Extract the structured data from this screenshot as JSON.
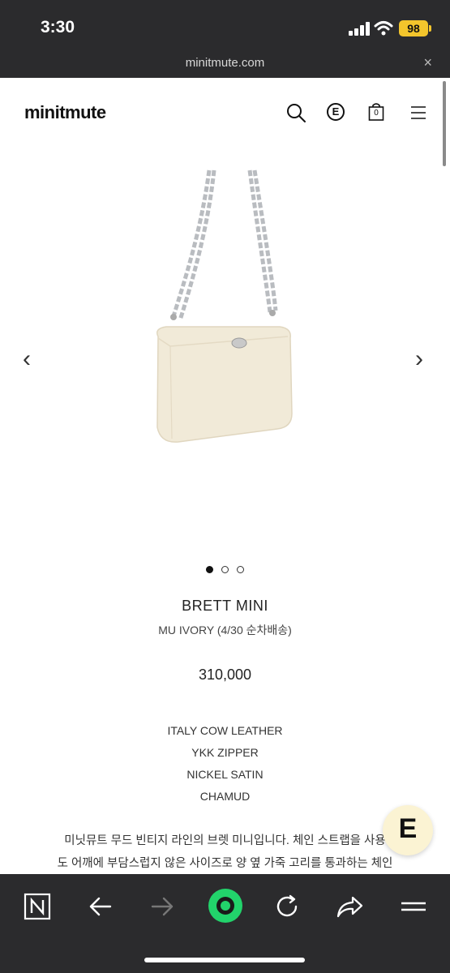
{
  "status_bar": {
    "time": "3:30",
    "battery": "98"
  },
  "browser": {
    "url": "minitmute.com",
    "close_label": "×"
  },
  "site": {
    "logo": "minitmute",
    "cart_count": "0",
    "e_badge": "E"
  },
  "product": {
    "name": "BRETT MINI",
    "variant": "MU IVORY (4/30 순차배송)",
    "price": "310,000",
    "specs": [
      "ITALY COW LEATHER",
      "YKK ZIPPER",
      "NICKEL SATIN",
      "CHAMUD"
    ],
    "description": [
      "미닛뮤트 무드 빈티지 라인의 브렛 미니입니다. 체인 스트랩을 사용",
      "도 어깨에 부담스럽지 않은 사이즈로 양 옆 가죽 고리를 통과하는 체인"
    ],
    "image_slide": 1,
    "image_count": 3
  },
  "nav_arrows": {
    "prev": "‹",
    "next": "›"
  },
  "floating_button": {
    "label": "E"
  },
  "colors": {
    "chrome": "#2b2b2d",
    "accent_green": "#22d36b",
    "bag_ivory": "#f1ead8",
    "battery": "#f3c52c"
  },
  "icons": [
    "search-icon",
    "e-icon",
    "cart-icon",
    "menu-icon",
    "n-icon",
    "back-icon",
    "forward-icon",
    "home-icon",
    "reload-icon",
    "share-icon",
    "menu-icon"
  ]
}
